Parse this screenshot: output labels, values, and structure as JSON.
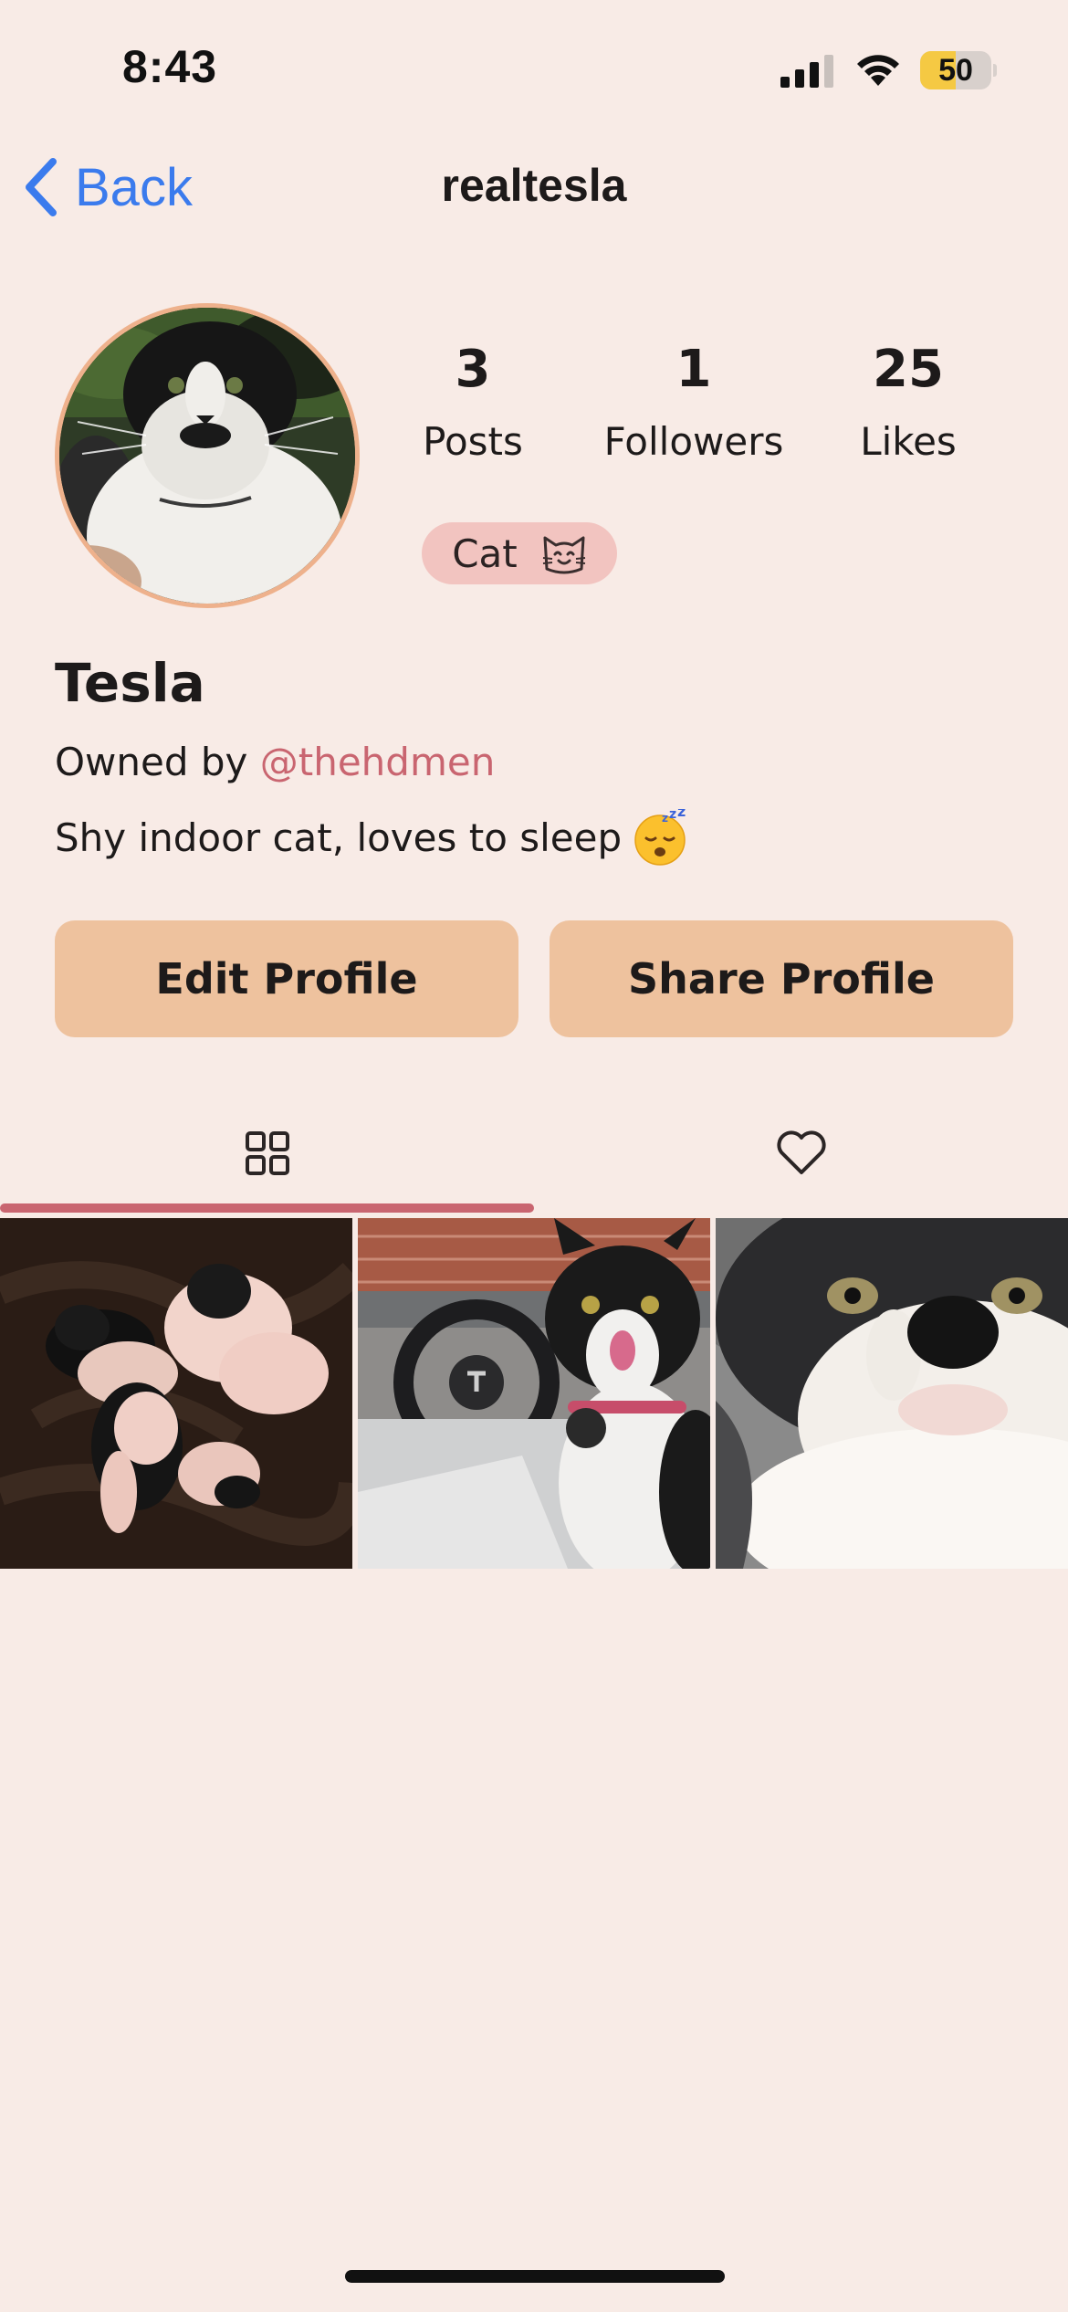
{
  "status_bar": {
    "time": "8:43",
    "battery_percent": 50,
    "battery_label": "50",
    "icons": [
      "cellular-signal-icon",
      "wifi-icon",
      "battery-icon"
    ]
  },
  "nav": {
    "back_label": "Back",
    "title": "realtesla"
  },
  "profile": {
    "avatar": "cat-avatar-photo",
    "stats": [
      {
        "value": "3",
        "label": "Posts"
      },
      {
        "value": "1",
        "label": "Followers"
      },
      {
        "value": "25",
        "label": "Likes"
      }
    ],
    "tag": {
      "label": "Cat",
      "icon": "cat-face-icon"
    },
    "name": "Tesla",
    "owned_prefix": "Owned by ",
    "owner_handle": "@thehdmen",
    "bio": "Shy indoor cat, loves to sleep",
    "bio_emoji": "sleeping-face-emoji"
  },
  "actions": {
    "edit_label": "Edit Profile",
    "share_label": "Share Profile"
  },
  "tabs": [
    {
      "icon": "grid-icon",
      "selected": true
    },
    {
      "icon": "heart-icon",
      "selected": false
    }
  ],
  "posts": [
    {
      "image": "two-cats-lying-on-blanket-photo"
    },
    {
      "image": "cat-in-car-licking-nose-photo"
    },
    {
      "image": "cat-face-closeup-photo"
    }
  ],
  "colors": {
    "background": "#f8ebe6",
    "accent": "#c96570",
    "link_blue": "#3b7bed",
    "button": "#eec29e",
    "tag": "#f2c4c0",
    "avatar_ring": "#eeb18c"
  }
}
